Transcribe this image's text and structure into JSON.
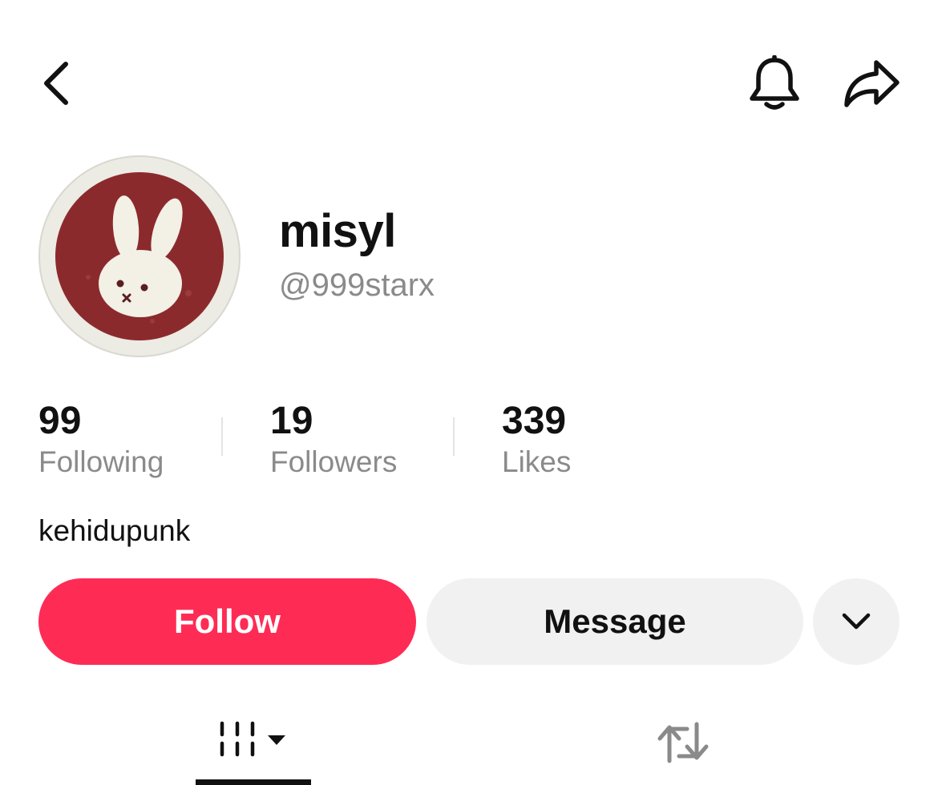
{
  "header": {
    "back_icon": "chevron-left-icon",
    "notification_icon": "bell-icon",
    "share_icon": "share-arrow-icon"
  },
  "profile": {
    "avatar_description": "white bunny on dark red circle",
    "display_name": "misyl",
    "handle": "@999starx",
    "bio": "kehidupunk"
  },
  "stats": [
    {
      "value": "99",
      "label": "Following"
    },
    {
      "value": "19",
      "label": "Followers"
    },
    {
      "value": "339",
      "label": "Likes"
    }
  ],
  "actions": {
    "follow_label": "Follow",
    "message_label": "Message",
    "more_icon": "chevron-down-icon"
  },
  "tabs": [
    {
      "icon": "videos-grid-icon",
      "active": true
    },
    {
      "icon": "repost-icon",
      "active": false
    }
  ],
  "colors": {
    "accent": "#fe2c55",
    "secondary_button": "#f1f1f1",
    "muted_text": "#8a8a8a",
    "avatar_red": "#8b2a2c"
  }
}
